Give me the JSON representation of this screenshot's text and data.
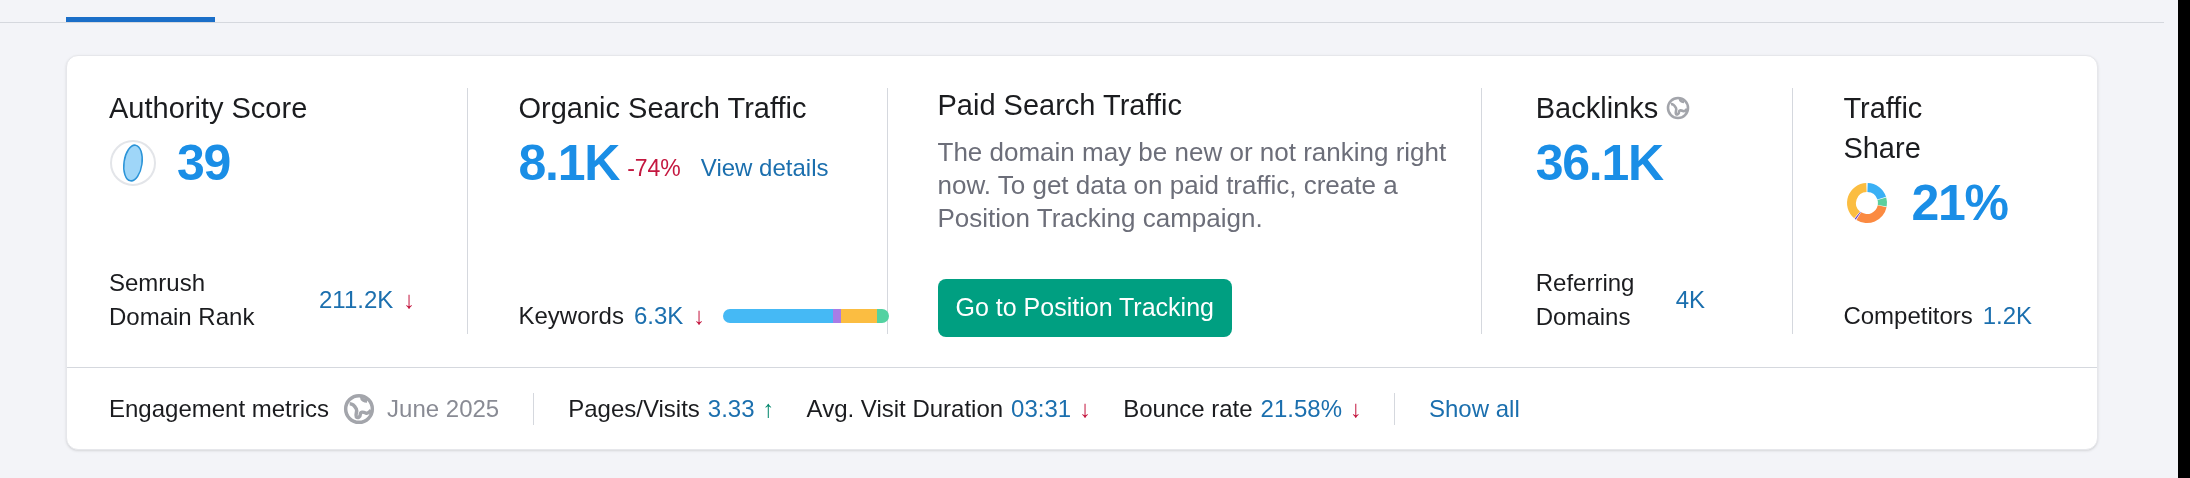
{
  "metrics": [
    {
      "kind": "authority",
      "title": "Authority Score",
      "value": "39",
      "footer_label": "Semrush Domain Rank",
      "footer_value": "211.2K",
      "footer_trend": "↓",
      "footer_trend_positive": false
    },
    {
      "kind": "organic",
      "title": "Organic Search Traffic",
      "value": "8.1K",
      "change": "-74%",
      "link": "View details",
      "footer_label": "Keywords",
      "footer_value": "6.3K",
      "footer_trend": "↓",
      "footer_trend_positive": false
    },
    {
      "kind": "paid",
      "title": "Paid Search Traffic",
      "description": "The domain may be new or not ranking right now. To get data on paid traffic, create a Position Tracking campaign.",
      "button": "Go to Position Tracking"
    },
    {
      "kind": "backlinks",
      "title": "Backlinks",
      "value": "36.1K",
      "footer_label": "Referring Domains",
      "footer_value": "4K"
    },
    {
      "kind": "share",
      "title": "Traffic Share",
      "value": "21%",
      "footer_label": "Competitors",
      "footer_value": "1.2K"
    }
  ],
  "engagement": {
    "label": "Engagement metrics",
    "date": "June 2025",
    "items": [
      {
        "label": "Pages/Visits",
        "value": "3.33",
        "trend": "↑",
        "trend_positive": true
      },
      {
        "label": "Avg. Visit Duration",
        "value": "03:31",
        "trend": "↓",
        "trend_positive": false
      },
      {
        "label": "Bounce rate",
        "value": "21.58%",
        "trend": "↓",
        "trend_positive": false
      }
    ],
    "link": "Show all"
  }
}
